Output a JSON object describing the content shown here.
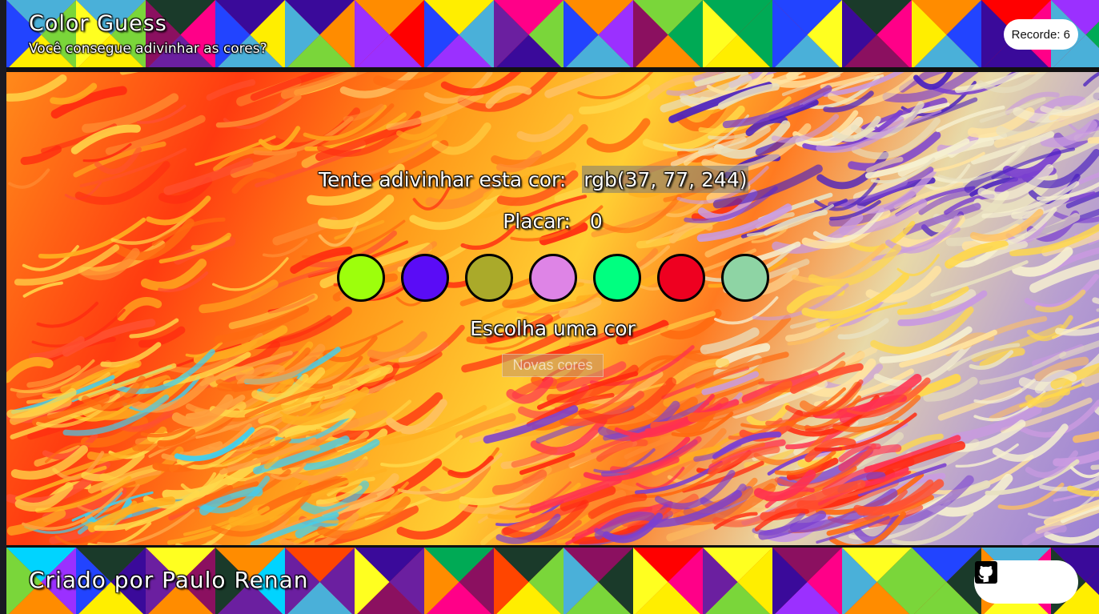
{
  "header": {
    "title": "Color Guess",
    "subtitle": "Você consegue adivinhar as cores?",
    "record_label": "Recorde: 6"
  },
  "game": {
    "prompt_label": "Tente adivinhar esta cor:",
    "target_rgb": "rgb(37, 77, 244)",
    "score_label": "Placar:",
    "score_value": "0",
    "swatches": [
      "#9dff0c",
      "#5a0cf6",
      "#aaaa2a",
      "#de84e6",
      "#00ff80",
      "#ee0020",
      "#8ed4a4"
    ],
    "message": "Escolha uma cor",
    "new_colors_button": "Novas cores"
  },
  "footer": {
    "credit": "Criado por Paulo Renan",
    "social_icons": [
      "linkedin-icon",
      "instagram-icon",
      "github-icon"
    ]
  }
}
